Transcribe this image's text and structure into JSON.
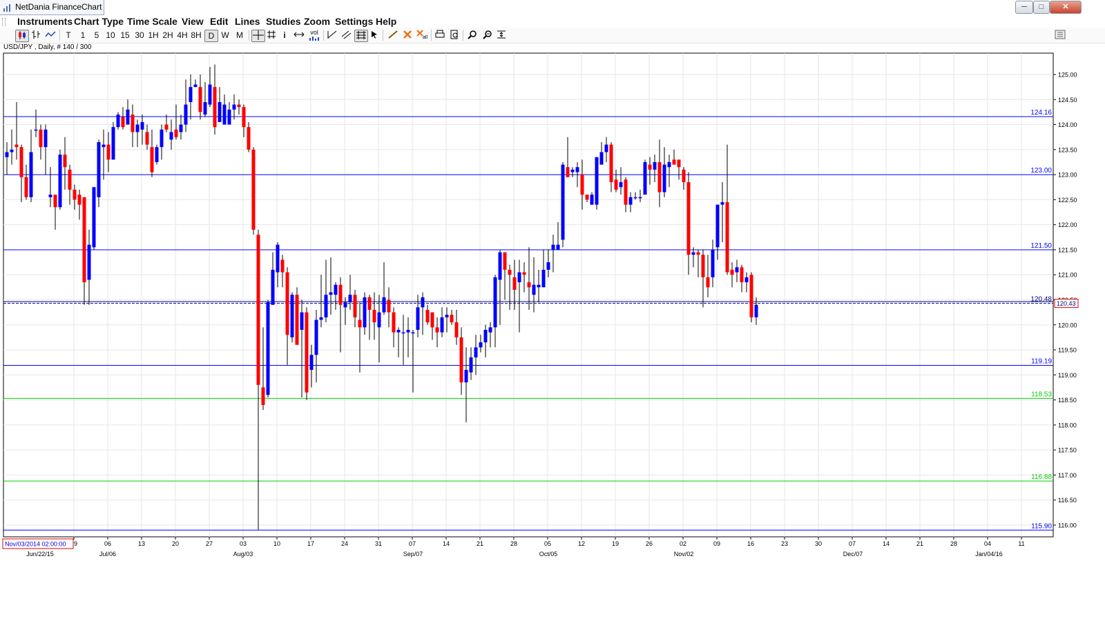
{
  "window": {
    "title": "NetDania FinanceChart",
    "controls": [
      "─",
      "□",
      "✕"
    ]
  },
  "menu": [
    "Instruments",
    "Chart Type",
    "Time Scale",
    "View",
    "Edit",
    "Lines",
    "Studies",
    "Zoom",
    "Settings",
    "Help"
  ],
  "toolbar": {
    "timeframes": [
      "T",
      "1",
      "5",
      "10",
      "15",
      "30",
      "1H",
      "2H",
      "4H",
      "8H",
      "D",
      "W",
      "M"
    ],
    "selected_timeframe": "D",
    "icons": [
      "candlestick-icon",
      "bar-chart-icon",
      "line-chart-icon",
      "crosshair-icon",
      "grid-icon",
      "info-icon",
      "scroll-icon",
      "volume-icon",
      "trendline-icon",
      "parallel-lines-icon",
      "fibonacci-icon",
      "cursor-icon",
      "pen-icon",
      "delete-icon",
      "delete-all-icon",
      "print-icon",
      "print-preview-icon",
      "zoom-in-icon",
      "zoom-out-icon",
      "fit-icon",
      "panel-icon"
    ],
    "volume_label": "vol"
  },
  "chart_info": "USD/JPY , Daily, # 140 / 300",
  "chart_data": {
    "type": "candlestick",
    "symbol": "USD/JPY",
    "interval": "Daily",
    "ylim": [
      115.6,
      125.5
    ],
    "y_ticks": [
      "125.00",
      "124.50",
      "124.00",
      "123.50",
      "123.00",
      "122.50",
      "122.00",
      "121.50",
      "121.00",
      "120.50",
      "120.00",
      "119.50",
      "119.00",
      "118.50",
      "118.00",
      "117.50",
      "117.00",
      "116.50",
      "116.00"
    ],
    "x_date_labels": [
      "Jun/22/15",
      "Jul/06",
      "Aug/03",
      "Sep/07",
      "Oct/05",
      "Nov/02",
      "Dec/07",
      "Jan/04/16"
    ],
    "x_day_labels": [
      "29",
      "06",
      "13",
      "20",
      "27",
      "03",
      "10",
      "17",
      "24",
      "31",
      "07",
      "14",
      "21",
      "28",
      "05",
      "12",
      "19",
      "26",
      "02",
      "09",
      "16",
      "23",
      "30",
      "07",
      "14",
      "21",
      "28",
      "04",
      "11"
    ],
    "cursor_date_label": "Nov/03/2014 02:00:00",
    "current_price": "120.43",
    "current_price_overlay": "120.48",
    "colors": {
      "up": "#0000ff",
      "down": "#ff0000",
      "wick": "#000000"
    },
    "horizontal_lines": [
      {
        "value": 124.16,
        "label": "124.16",
        "color": "#0000ff"
      },
      {
        "value": 123.0,
        "label": "123.00",
        "color": "#0000ff"
      },
      {
        "value": 121.5,
        "label": "121.50",
        "color": "#0000ff"
      },
      {
        "value": 119.19,
        "label": "119.19",
        "color": "#0000ff"
      },
      {
        "value": 118.53,
        "label": "118.53",
        "color": "#00cc00"
      },
      {
        "value": 116.88,
        "label": "116.88",
        "color": "#00cc00"
      },
      {
        "value": 115.9,
        "label": "115.90",
        "color": "#0000ff"
      }
    ],
    "candles": [
      [
        123.35,
        123.45,
        123.65,
        123.0
      ],
      [
        123.45,
        123.5,
        123.9,
        123.2
      ],
      [
        123.6,
        123.55,
        124.45,
        123.3
      ],
      [
        123.55,
        122.95,
        123.6,
        122.45
      ],
      [
        122.95,
        122.55,
        123.2,
        122.5
      ],
      [
        122.55,
        123.45,
        123.9,
        122.45
      ],
      [
        123.9,
        123.9,
        124.3,
        123.75
      ],
      [
        123.9,
        123.55,
        124.0,
        123.3
      ],
      [
        123.55,
        123.9,
        124.0,
        123.0
      ],
      [
        122.55,
        122.6,
        123.15,
        122.35
      ],
      [
        122.6,
        122.35,
        122.6,
        121.9
      ],
      [
        122.35,
        123.4,
        123.5,
        122.3
      ],
      [
        123.4,
        123.15,
        123.75,
        122.7
      ],
      [
        123.1,
        122.7,
        123.2,
        122.4
      ],
      [
        122.7,
        122.5,
        122.8,
        122.3
      ],
      [
        122.6,
        122.4,
        122.7,
        122.1
      ],
      [
        122.55,
        120.85,
        122.55,
        120.4
      ],
      [
        120.9,
        121.6,
        121.9,
        120.4
      ],
      [
        121.55,
        122.75,
        122.75,
        121.5
      ],
      [
        122.55,
        123.65,
        123.7,
        122.35
      ],
      [
        123.55,
        123.6,
        123.9,
        122.9
      ],
      [
        123.6,
        123.3,
        123.85,
        123.05
      ],
      [
        123.3,
        123.95,
        124.05,
        123.3
      ],
      [
        123.95,
        124.2,
        124.25,
        123.9
      ],
      [
        124.15,
        123.95,
        124.35,
        123.9
      ],
      [
        124.0,
        124.3,
        124.5,
        124.0
      ],
      [
        124.2,
        123.85,
        124.4,
        123.55
      ],
      [
        123.85,
        124.0,
        124.1,
        123.55
      ],
      [
        123.9,
        124.05,
        124.2,
        123.6
      ],
      [
        123.85,
        123.6,
        124.0,
        123.5
      ],
      [
        123.55,
        123.05,
        123.9,
        122.95
      ],
      [
        123.25,
        123.55,
        123.6,
        123.2
      ],
      [
        123.55,
        123.9,
        124.0,
        123.3
      ],
      [
        124.0,
        123.9,
        124.2,
        123.85
      ],
      [
        123.7,
        123.85,
        124.1,
        123.5
      ],
      [
        123.9,
        123.75,
        124.4,
        123.7
      ],
      [
        123.85,
        124.0,
        124.2,
        123.7
      ],
      [
        124.0,
        124.4,
        124.9,
        123.85
      ],
      [
        124.45,
        124.75,
        125.0,
        124.1
      ],
      [
        124.75,
        124.8,
        124.9,
        124.75
      ],
      [
        124.75,
        124.25,
        125.0,
        124.1
      ],
      [
        124.2,
        124.45,
        124.85,
        124.15
      ],
      [
        124.4,
        124.8,
        125.15,
        124.35
      ],
      [
        124.75,
        123.95,
        125.2,
        123.8
      ],
      [
        124.05,
        124.45,
        124.75,
        124.1
      ],
      [
        124.0,
        124.4,
        124.6,
        124.0
      ],
      [
        124.0,
        124.3,
        124.45,
        124.15
      ],
      [
        124.3,
        124.4,
        124.6,
        124.1
      ],
      [
        124.4,
        124.35,
        124.5,
        124.2
      ],
      [
        124.35,
        123.95,
        124.4,
        123.75
      ],
      [
        123.95,
        123.5,
        124.05,
        123.45
      ],
      [
        123.5,
        121.9,
        123.55,
        121.8
      ],
      [
        121.8,
        118.8,
        121.9,
        115.9
      ],
      [
        118.75,
        118.4,
        119.95,
        118.3
      ],
      [
        118.6,
        120.45,
        120.5,
        118.55
      ],
      [
        120.4,
        121.1,
        121.45,
        120.4
      ],
      [
        121.05,
        121.6,
        121.65,
        120.75
      ],
      [
        121.3,
        121.05,
        121.4,
        120.75
      ],
      [
        121.05,
        119.8,
        121.15,
        119.2
      ],
      [
        119.75,
        120.6,
        120.65,
        119.65
      ],
      [
        120.6,
        119.6,
        120.75,
        119.65
      ],
      [
        119.9,
        120.25,
        120.5,
        118.55
      ],
      [
        120.25,
        118.65,
        120.35,
        118.5
      ],
      [
        119.1,
        119.4,
        119.6,
        118.75
      ],
      [
        119.4,
        120.1,
        120.3,
        118.85
      ],
      [
        120.1,
        120.15,
        121.0,
        119.95
      ],
      [
        120.15,
        120.6,
        121.3,
        120.05
      ],
      [
        120.6,
        120.65,
        121.35,
        120.2
      ],
      [
        120.6,
        120.8,
        120.85,
        120.3
      ],
      [
        120.8,
        120.4,
        120.95,
        119.45
      ],
      [
        120.35,
        120.45,
        120.55,
        120.0
      ],
      [
        120.45,
        120.6,
        121.0,
        120.3
      ],
      [
        120.6,
        120.15,
        120.7,
        119.95
      ],
      [
        120.1,
        119.95,
        120.45,
        119.05
      ],
      [
        119.95,
        120.55,
        120.65,
        119.8
      ],
      [
        120.55,
        120.3,
        120.6,
        119.7
      ],
      [
        120.3,
        120.05,
        120.65,
        119.7
      ],
      [
        119.95,
        120.25,
        120.6,
        119.25
      ],
      [
        120.25,
        120.55,
        121.25,
        120.2
      ],
      [
        120.5,
        120.25,
        120.75,
        119.95
      ],
      [
        120.25,
        119.85,
        120.35,
        119.55
      ],
      [
        119.85,
        119.9,
        119.95,
        119.35
      ],
      [
        119.85,
        119.85,
        120.2,
        119.2
      ],
      [
        119.85,
        119.9,
        120.15,
        119.35
      ],
      [
        119.85,
        119.85,
        119.9,
        118.65
      ],
      [
        119.9,
        120.35,
        120.6,
        119.75
      ],
      [
        120.35,
        120.55,
        120.65,
        119.8
      ],
      [
        120.3,
        120.05,
        120.4,
        120.0
      ],
      [
        120.25,
        119.95,
        120.25,
        119.7
      ],
      [
        119.95,
        119.85,
        120.15,
        119.55
      ],
      [
        119.85,
        120.15,
        120.35,
        119.75
      ],
      [
        120.15,
        120.2,
        120.35,
        119.85
      ],
      [
        120.2,
        120.05,
        120.3,
        120.0
      ],
      [
        120.05,
        119.75,
        120.3,
        119.6
      ],
      [
        119.75,
        118.85,
        119.95,
        118.6
      ],
      [
        118.85,
        119.1,
        119.55,
        118.05
      ],
      [
        119.05,
        119.35,
        119.55,
        118.9
      ],
      [
        119.35,
        119.55,
        119.8,
        119.0
      ],
      [
        119.55,
        119.65,
        119.8,
        119.45
      ],
      [
        119.65,
        119.9,
        120.0,
        119.35
      ],
      [
        119.85,
        119.95,
        120.05,
        119.55
      ],
      [
        119.95,
        120.95,
        121.0,
        119.55
      ],
      [
        120.9,
        121.45,
        121.5,
        120.0
      ],
      [
        121.45,
        121.1,
        121.4,
        120.5
      ],
      [
        121.1,
        121.0,
        121.2,
        120.3
      ],
      [
        120.95,
        120.7,
        121.3,
        120.3
      ],
      [
        120.85,
        121.05,
        121.3,
        119.85
      ],
      [
        121.05,
        121.0,
        121.25,
        120.65
      ],
      [
        120.85,
        120.75,
        121.55,
        120.3
      ],
      [
        120.6,
        120.8,
        121.35,
        120.25
      ],
      [
        120.75,
        120.8,
        121.1,
        120.45
      ],
      [
        120.75,
        121.1,
        121.5,
        120.85
      ],
      [
        121.1,
        121.25,
        121.5,
        120.95
      ],
      [
        121.5,
        121.6,
        121.8,
        121.05
      ],
      [
        121.5,
        121.6,
        122.05,
        121.5
      ],
      [
        121.7,
        123.2,
        123.25,
        121.55
      ],
      [
        123.15,
        122.95,
        123.75,
        122.95
      ],
      [
        123.05,
        123.1,
        123.15,
        122.95
      ],
      [
        123.05,
        123.15,
        123.25,
        122.75
      ],
      [
        123.0,
        122.6,
        123.3,
        122.3
      ],
      [
        122.6,
        122.5,
        122.6,
        122.45
      ],
      [
        122.4,
        122.6,
        122.65,
        122.4
      ],
      [
        122.4,
        123.35,
        123.35,
        122.3
      ],
      [
        123.2,
        123.45,
        123.65,
        123.25
      ],
      [
        123.45,
        123.6,
        123.75,
        123.25
      ],
      [
        123.6,
        122.85,
        123.65,
        122.65
      ],
      [
        122.9,
        122.7,
        123.1,
        122.65
      ],
      [
        122.75,
        122.85,
        123.15,
        122.6
      ],
      [
        122.9,
        122.4,
        122.95,
        122.25
      ],
      [
        122.4,
        122.55,
        122.65,
        122.25
      ],
      [
        122.55,
        122.55,
        122.65,
        122.5
      ],
      [
        122.55,
        122.55,
        122.7,
        122.45
      ],
      [
        122.6,
        123.25,
        123.3,
        122.7
      ],
      [
        123.2,
        123.1,
        123.35,
        122.8
      ],
      [
        123.1,
        123.25,
        123.4,
        122.85
      ],
      [
        123.25,
        122.65,
        123.7,
        122.35
      ],
      [
        122.65,
        123.2,
        123.55,
        122.55
      ],
      [
        123.15,
        123.25,
        123.4,
        122.75
      ],
      [
        123.3,
        123.2,
        123.5,
        123.25
      ],
      [
        123.3,
        123.15,
        123.3,
        122.9
      ],
      [
        123.1,
        122.85,
        123.15,
        122.7
      ],
      [
        122.85,
        121.4,
        123.05,
        121.0
      ],
      [
        121.4,
        121.45,
        121.55,
        121.15
      ],
      [
        121.45,
        121.4,
        121.5,
        120.95
      ],
      [
        121.4,
        120.95,
        121.5,
        120.35
      ],
      [
        120.95,
        120.75,
        121.4,
        120.55
      ],
      [
        120.95,
        121.5,
        121.7,
        120.75
      ],
      [
        121.55,
        122.4,
        122.4,
        121.3
      ],
      [
        122.4,
        122.45,
        122.85,
        121.65
      ],
      [
        122.45,
        121.05,
        123.6,
        121.0
      ],
      [
        121.1,
        121.0,
        121.25,
        120.75
      ],
      [
        121.05,
        121.15,
        121.3,
        120.85
      ],
      [
        121.15,
        120.85,
        121.2,
        120.65
      ],
      [
        120.85,
        120.95,
        121.05,
        120.65
      ],
      [
        121.0,
        120.15,
        121.05,
        120.05
      ],
      [
        120.15,
        120.4,
        120.55,
        120.0
      ]
    ]
  }
}
